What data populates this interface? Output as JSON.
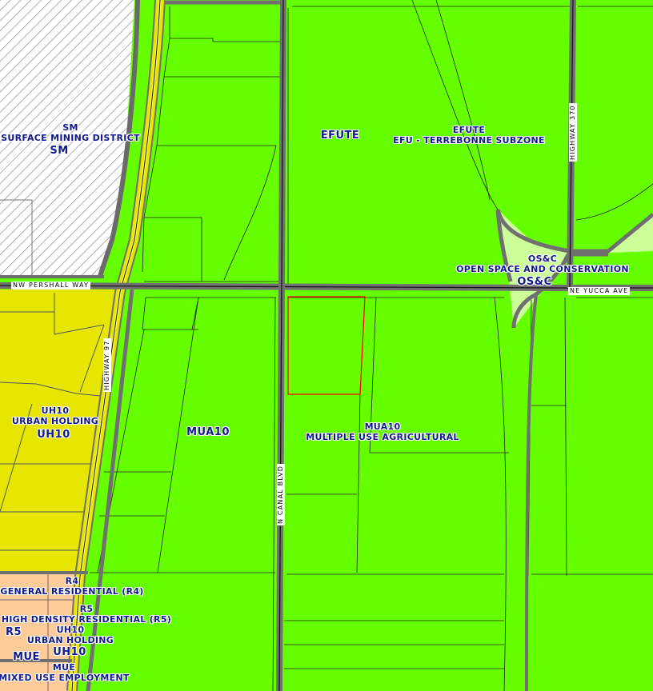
{
  "zones": {
    "sm": {
      "code": "SM",
      "name": "SURFACE MINING DISTRICT",
      "code_large": "SM"
    },
    "efute_big": "EFUTE",
    "efute": {
      "code": "EFUTE",
      "name": "EFU - TERREBONNE SUBZONE"
    },
    "osc": {
      "code": "OS&C",
      "name": "OPEN SPACE AND CONSERVATION",
      "code_large": "OS&C"
    },
    "uh10": {
      "code": "UH10",
      "name": "URBAN HOLDING",
      "code_large": "UH10"
    },
    "mua10_big": "MUA10",
    "mua10": {
      "code": "MUA10",
      "name": "MULTIPLE USE AGRICULTURAL"
    },
    "r4": {
      "code": "R4",
      "name": "GENERAL RESIDENTIAL (R4)"
    },
    "r5": {
      "code": "R5",
      "name": "HIGH DENSITY RESIDENTIAL (R5)",
      "code_large": "R5"
    },
    "uh10_south": {
      "code": "UH10",
      "name": "URBAN HOLDING",
      "code_large": "UH10"
    },
    "mue": {
      "code": "MUE",
      "name": "MIXED USE EMPLOYMENT",
      "code_large": "MUE"
    }
  },
  "roads": {
    "pershall": "NW PERSHALL WAY",
    "yucca": "NE YUCCA AVE",
    "hwy97": "HIGHWAY 97",
    "hwy370": "HIGHWAY 370",
    "canal": "N CANAL BLVD"
  },
  "colors": {
    "efu_green": "#66ff00",
    "osc_green": "#ccff99",
    "urban_holding_yellow": "#e6e600",
    "residential_orange": "#ffcc99",
    "road_gray": "#707070",
    "highway_yellow": "#ffff66",
    "selected_parcel": "#ff0000",
    "label_blue": "#101a8c"
  }
}
